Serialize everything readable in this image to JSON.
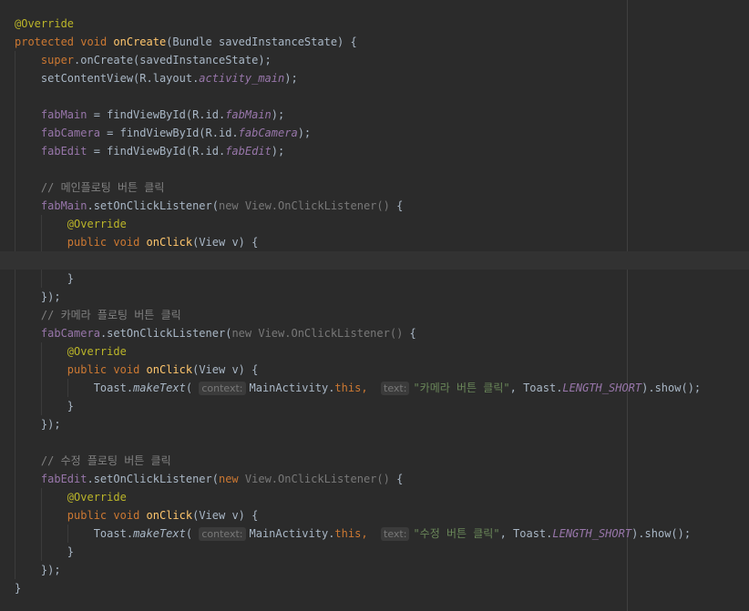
{
  "colors": {
    "background": "#2b2b2b",
    "keyword": "#cc7832",
    "annotation": "#bbb529",
    "method_decl": "#ffc66d",
    "field": "#9876aa",
    "comment": "#808080",
    "string": "#6a8759",
    "default_text": "#a9b7c6"
  },
  "code": {
    "annotation": "@Override",
    "kw_protected": "protected",
    "kw_void": "void",
    "kw_public": "public",
    "kw_new": "new",
    "kw_super": "super",
    "kw_this": "this",
    "on_create": "onCreate",
    "on_create_params": "(Bundle savedInstanceState) {",
    "super_rest": ".onCreate(savedInstanceState);",
    "set_content_view": "setContentView(R.layout.",
    "activity_main": "activity_main",
    "close_paren_semi": ");",
    "fab_main": "fabMain",
    "fab_camera": "fabCamera",
    "fab_edit": "fabEdit",
    "find_view": " = findViewById(R.id.",
    "comment_main": "// 메인플로팅 버튼 클릭",
    "comment_camera": "// 카메라 플로팅 버튼 클릭",
    "comment_edit": "// 수정 플로팅 버튼 클릭",
    "set_listener": ".setOnClickListener(",
    "view_listener": "View.OnClickListener()",
    "open_brace": " {",
    "on_click": "onClick",
    "view_param": "(View v) {",
    "close_brace": "}",
    "close_listener": "});",
    "toast": "Toast.",
    "make_text": "makeText",
    "open_paren": "(",
    "hint_context": "context:",
    "main_activity": "MainActivity.",
    "comma": ",",
    "hint_text": "text:",
    "toast_camera": "\"카메라 버튼 클릭\"",
    "toast_edit": "\"수정 버튼 클릭\"",
    "toast_comma": ", Toast.",
    "length_short": "LENGTH_SHORT",
    "show": ").show();"
  }
}
